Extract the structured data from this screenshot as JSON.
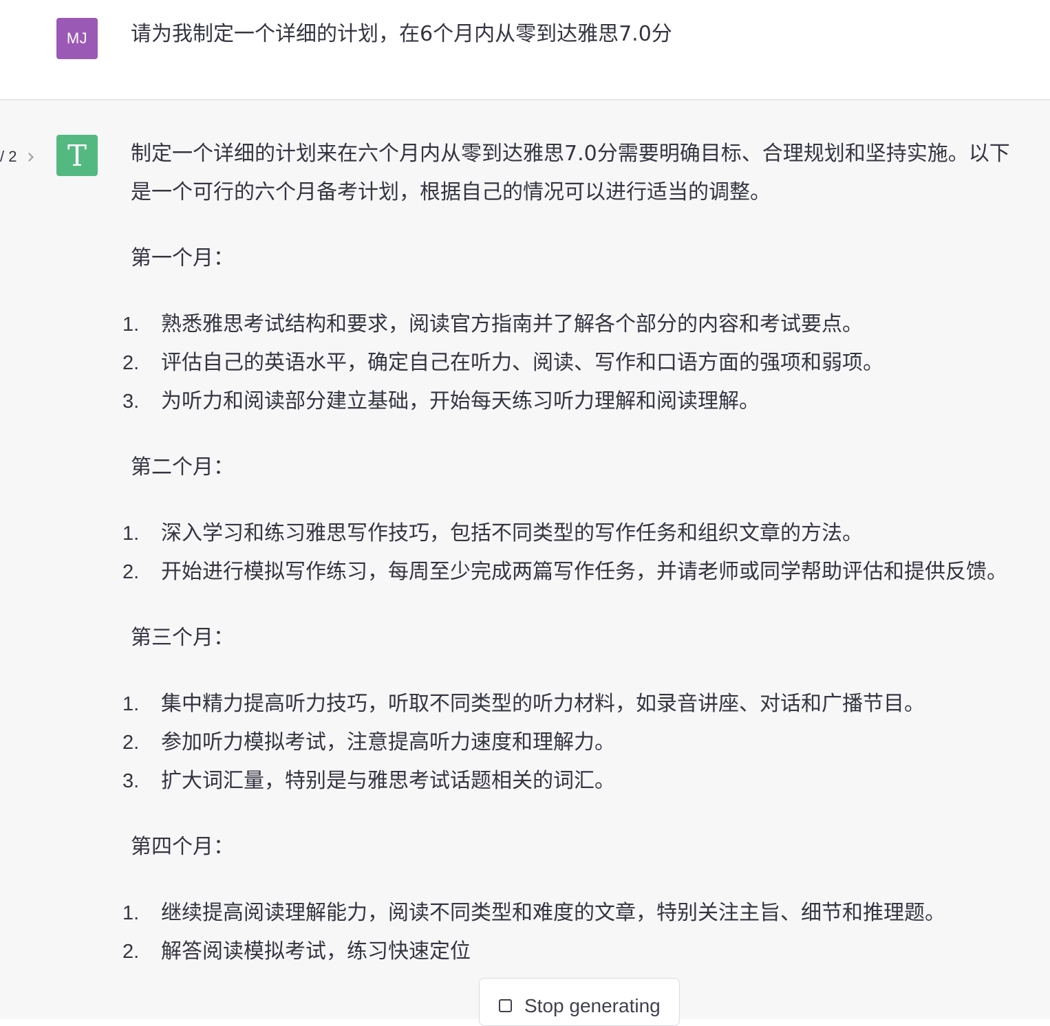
{
  "user_message": {
    "avatar_initials": "MJ",
    "text": "请为我制定一个详细的计划，在6个月内从零到达雅思7.0分"
  },
  "assistant_message": {
    "pager": "/ 2",
    "avatar_glyph": "T",
    "intro": "制定一个详细的计划来在六个月内从零到达雅思7.0分需要明确目标、合理规划和坚持实施。以下是一个可行的六个月备考计划，根据自己的情况可以进行适当的调整。",
    "sections": [
      {
        "title": "第一个月：",
        "items": [
          {
            "num": "1.",
            "text": "熟悉雅思考试结构和要求，阅读官方指南并了解各个部分的内容和考试要点。"
          },
          {
            "num": "2.",
            "text": "评估自己的英语水平，确定自己在听力、阅读、写作和口语方面的强项和弱项。"
          },
          {
            "num": "3.",
            "text": "为听力和阅读部分建立基础，开始每天练习听力理解和阅读理解。"
          }
        ]
      },
      {
        "title": "第二个月：",
        "items": [
          {
            "num": "1.",
            "text": "深入学习和练习雅思写作技巧，包括不同类型的写作任务和组织文章的方法。"
          },
          {
            "num": "2.",
            "text": "开始进行模拟写作练习，每周至少完成两篇写作任务，并请老师或同学帮助评估和提供反馈。"
          }
        ]
      },
      {
        "title": "第三个月：",
        "items": [
          {
            "num": "1.",
            "text": "集中精力提高听力技巧，听取不同类型的听力材料，如录音讲座、对话和广播节目。"
          },
          {
            "num": "2.",
            "text": "参加听力模拟考试，注意提高听力速度和理解力。"
          },
          {
            "num": "3.",
            "text": "扩大词汇量，特别是与雅思考试话题相关的词汇。"
          }
        ]
      },
      {
        "title": "第四个月：",
        "items": [
          {
            "num": "1.",
            "text": "继续提高阅读理解能力，阅读不同类型和难度的文章，特别关注主旨、细节和推理题。"
          },
          {
            "num": "2.",
            "text": "解答阅读模拟考试，练习快速定位"
          }
        ]
      }
    ]
  },
  "stop_button": {
    "label": "Stop generating",
    "icon": "stop-square-icon"
  },
  "colors": {
    "user_avatar": "#9b59b6",
    "assistant_avatar": "#54b981",
    "assistant_background": "#f7f7f8",
    "text": "#343541"
  }
}
